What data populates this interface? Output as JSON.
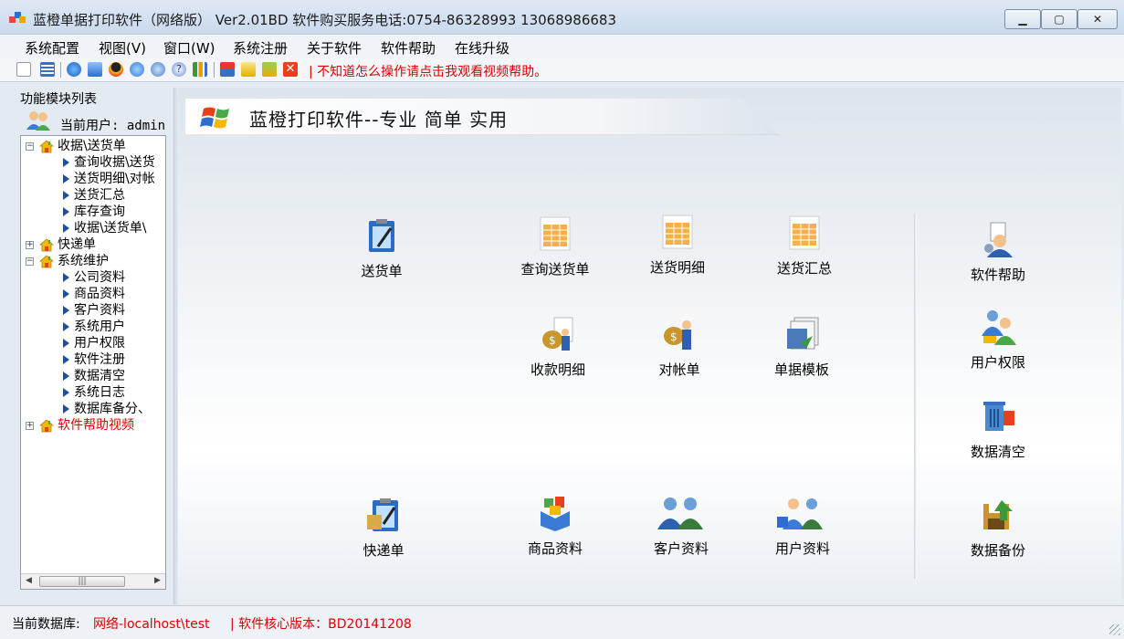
{
  "window": {
    "title": "蓝橙单据打印软件（网络版） Ver2.01BD  软件购买服务电话:0754-86328993 13068986683",
    "minimize": "▁",
    "maximize": "▢",
    "close": "✕"
  },
  "menu": [
    "系统配置",
    "视图(V)",
    "窗口(W)",
    "系统注册",
    "关于软件",
    "软件帮助",
    "在线升级"
  ],
  "toolbar": {
    "icons": [
      "new-doc-icon",
      "table-icon",
      "ie-icon",
      "ie-icon",
      "qq-icon",
      "user-icon",
      "globe-icon",
      "help-icon",
      "chart-icon",
      "print-icon",
      "folder-icon",
      "export-icon",
      "close-red-icon"
    ],
    "help_text": "| 不知道怎么操作请点击我观看视频帮助。"
  },
  "left_panel": {
    "title": "功能模块列表",
    "current_user": "当前用户: admin",
    "tree": [
      {
        "label": "收据\\送货单",
        "level": 0,
        "expanded": true
      },
      {
        "label": "查询收据\\送货",
        "level": 1
      },
      {
        "label": "送货明细\\对帐",
        "level": 1
      },
      {
        "label": "送货汇总",
        "level": 1
      },
      {
        "label": "库存查询",
        "level": 1
      },
      {
        "label": "收据\\送货单\\",
        "level": 1
      },
      {
        "label": "快递单",
        "level": 0,
        "expanded": false
      },
      {
        "label": "系统维护",
        "level": 0,
        "expanded": true
      },
      {
        "label": "公司资料",
        "level": 1
      },
      {
        "label": "商品资料",
        "level": 1
      },
      {
        "label": "客户资料",
        "level": 1
      },
      {
        "label": "系统用户",
        "level": 1
      },
      {
        "label": "用户权限",
        "level": 1
      },
      {
        "label": "软件注册",
        "level": 1
      },
      {
        "label": "数据清空",
        "level": 1
      },
      {
        "label": "系统日志",
        "level": 1
      },
      {
        "label": "数据库备分、",
        "level": 1
      },
      {
        "label": "软件帮助视频",
        "level": 0,
        "expanded": false,
        "color": "#e00000"
      }
    ],
    "scroll_left": "◀",
    "scroll_right": "▶",
    "scroll_thumb": "|||"
  },
  "banner": {
    "text": "蓝橙打印软件--专业 简单 实用"
  },
  "functions": {
    "delivery": "送货单",
    "query_delivery": "查询送货单",
    "delivery_detail": "送货明细",
    "delivery_summary": "送货汇总",
    "receipt_detail": "收款明细",
    "reconcile": "对帐单",
    "templates": "单据模板",
    "express": "快递单",
    "products": "商品资料",
    "customers": "客户资料",
    "users": "用户资料",
    "help": "软件帮助",
    "permissions": "用户权限",
    "clear_data": "数据清空",
    "backup": "数据备份"
  },
  "status": {
    "db_label": "当前数据库:",
    "db_value": "网络-localhost\\test",
    "version": "| 软件核心版本：BD20141208"
  },
  "colors": {
    "accent_red": "#e00000",
    "arrow_blue": "#1f4fa3"
  }
}
